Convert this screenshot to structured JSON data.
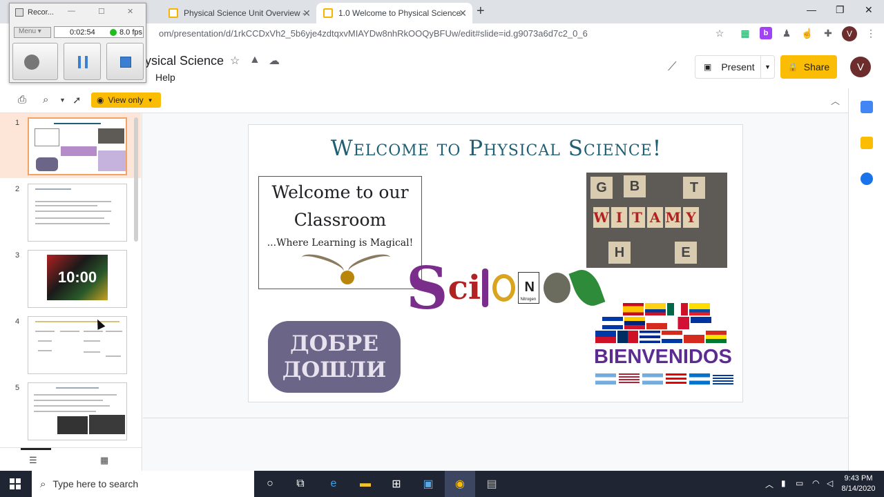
{
  "browser": {
    "tabs": [
      {
        "title": "Physical Science Unit Overview -",
        "active": false
      },
      {
        "title": "1.0 Welcome to Physical Science",
        "active": true
      }
    ],
    "url_host": "",
    "url": "om/presentation/d/1rkCCDxVh2_5b6yje4zdtqxvMIAYDw8nhRkOOQyBFUw/edit#slide=id.g9073a6d7c2_0_6",
    "profile_initial": "V"
  },
  "recorder": {
    "title": "Recor...",
    "menu_label": "Menu",
    "elapsed": "0:02:54",
    "fps": "8.0 fps"
  },
  "slides": {
    "doc_title": "ysical Science",
    "menu_help": "Help",
    "present_label": "Present",
    "share_label": "Share",
    "profile_initial": "V",
    "view_only_label": "View only"
  },
  "filmstrip": {
    "items": [
      {
        "number": "1",
        "selected": true
      },
      {
        "number": "2",
        "selected": false
      },
      {
        "number": "3",
        "selected": false,
        "timer_text": "10:00"
      },
      {
        "number": "4",
        "selected": false
      },
      {
        "number": "5",
        "selected": false
      }
    ]
  },
  "slide": {
    "title": "Welcome to Physical Science!",
    "welcome_line1": "Welcome to our",
    "welcome_line2": "Classroom",
    "welcome_line3": "...Where Learning is Magical!",
    "witamy_letters": [
      "W",
      "I",
      "T",
      "A",
      "M",
      "Y"
    ],
    "science_s": "S",
    "science_ci": "ci",
    "element_symbol": "N",
    "element_name": "Nitrogen",
    "element_mass": "14.0067",
    "dobre_line1": "ДОБРЕ",
    "dobre_line2": "ДОШЛИ",
    "bienvenidos": "BIENVENIDOS"
  },
  "taskbar": {
    "search_placeholder": "Type here to search",
    "time": "9:43 PM",
    "date": "8/14/2020"
  },
  "colors": {
    "accent_yellow": "#fbbc04",
    "selected_slide_bg": "#fde6d7",
    "slide_title_color": "#1e5f74",
    "taskbar_bg": "#1f2533"
  }
}
